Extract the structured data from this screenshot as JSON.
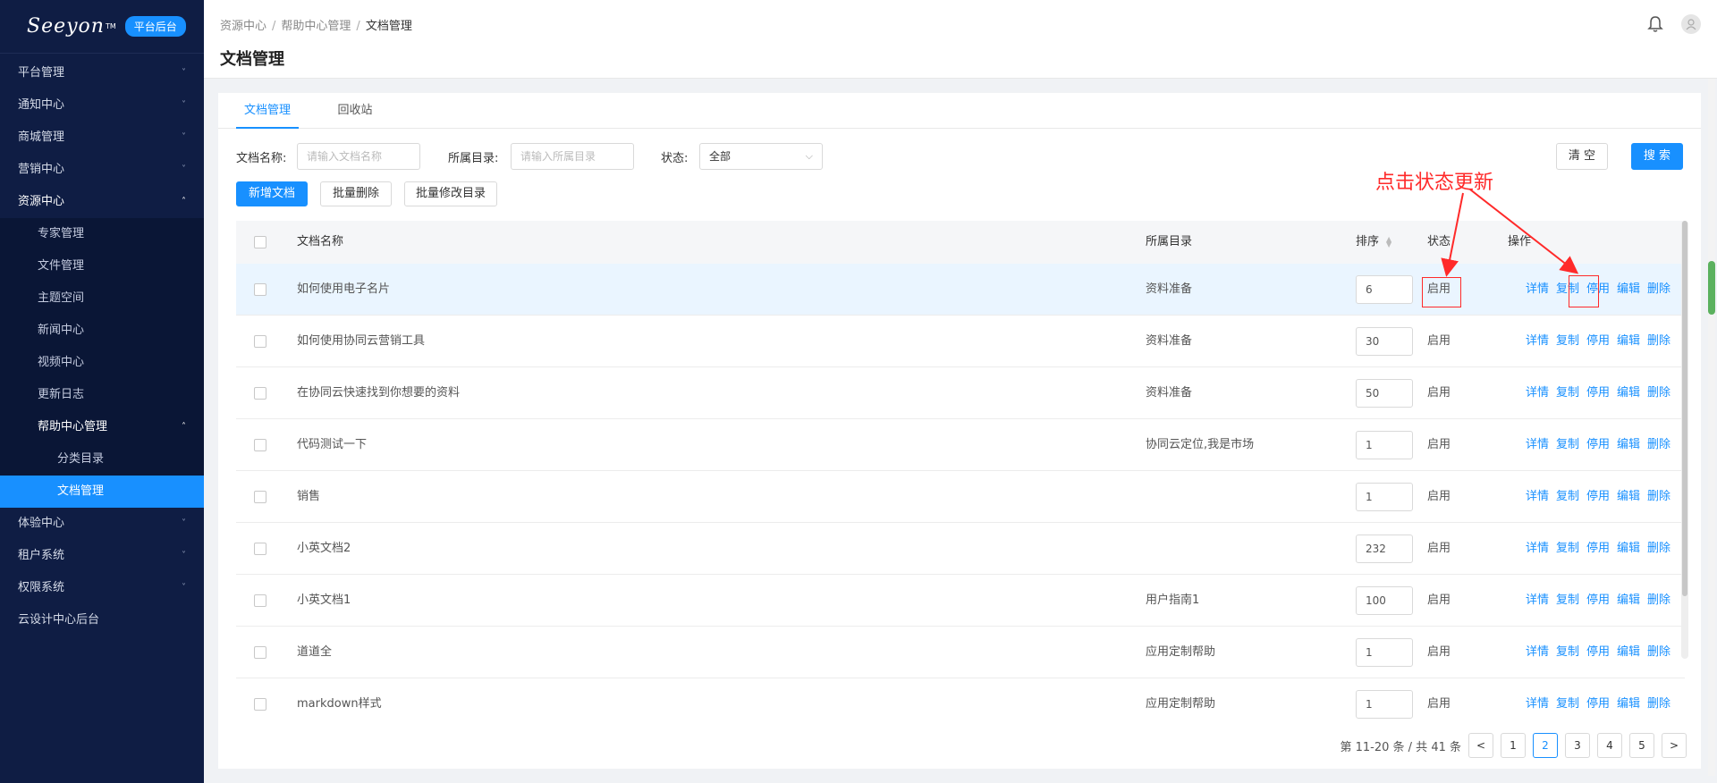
{
  "sidebar": {
    "logo": "Seeyon",
    "logo_tm": "TM",
    "badge": "平台后台",
    "items": [
      {
        "label": "平台管理",
        "arrow": "˅"
      },
      {
        "label": "通知中心",
        "arrow": "˅"
      },
      {
        "label": "商城管理",
        "arrow": "˅"
      },
      {
        "label": "营销中心",
        "arrow": "˅"
      },
      {
        "label": "资源中心",
        "arrow": "˄"
      },
      {
        "label": "专家管理"
      },
      {
        "label": "文件管理"
      },
      {
        "label": "主题空间"
      },
      {
        "label": "新闻中心"
      },
      {
        "label": "视频中心"
      },
      {
        "label": "更新日志"
      },
      {
        "label": "帮助中心管理",
        "arrow": "˄"
      },
      {
        "label": "分类目录"
      },
      {
        "label": "文档管理"
      },
      {
        "label": "体验中心",
        "arrow": "˅"
      },
      {
        "label": "租户系统",
        "arrow": "˅"
      },
      {
        "label": "权限系统",
        "arrow": "˅"
      },
      {
        "label": "云设计中心后台"
      }
    ]
  },
  "header": {
    "breadcrumb": [
      "资源中心",
      "帮助中心管理",
      "文档管理"
    ],
    "separator": "/",
    "title": "文档管理"
  },
  "tabs": [
    "文档管理",
    "回收站"
  ],
  "filters": {
    "name_label": "文档名称:",
    "name_placeholder": "请输入文档名称",
    "dir_label": "所属目录:",
    "dir_placeholder": "请输入所属目录",
    "status_label": "状态:",
    "status_value": "全部",
    "clear": "清 空",
    "search": "搜 索"
  },
  "actions": {
    "new_doc": "新增文档",
    "batch_delete": "批量删除",
    "batch_move": "批量修改目录"
  },
  "table": {
    "headers": {
      "name": "文档名称",
      "dir": "所属目录",
      "sort": "排序",
      "status": "状态",
      "ops": "操作"
    },
    "ops": [
      "详情",
      "复制",
      "停用",
      "编辑",
      "删除"
    ],
    "rows": [
      {
        "name": "如何使用电子名片",
        "dir": "资料准备",
        "sort": "6",
        "status": "启用"
      },
      {
        "name": "如何使用协同云营销工具",
        "dir": "资料准备",
        "sort": "30",
        "status": "启用"
      },
      {
        "name": "在协同云快速找到你想要的资料",
        "dir": "资料准备",
        "sort": "50",
        "status": "启用"
      },
      {
        "name": "代码测试一下",
        "dir": "协同云定位,我是市场",
        "sort": "1",
        "status": "启用"
      },
      {
        "name": "销售",
        "dir": "",
        "sort": "1",
        "status": "启用"
      },
      {
        "name": "小英文档2",
        "dir": "",
        "sort": "232",
        "status": "启用"
      },
      {
        "name": "小英文档1",
        "dir": "用户指南1",
        "sort": "100",
        "status": "启用"
      },
      {
        "name": "道道全",
        "dir": "应用定制帮助",
        "sort": "1",
        "status": "启用"
      },
      {
        "name": "markdown样式",
        "dir": "应用定制帮助",
        "sort": "1",
        "status": "启用"
      }
    ]
  },
  "pagination": {
    "summary": "第 11-20 条 / 共 41 条",
    "pages": [
      "1",
      "2",
      "3",
      "4",
      "5"
    ],
    "current": "2",
    "prev": "<",
    "next": ">"
  },
  "annotation": {
    "text": "点击状态更新",
    "color": "#ff2a2a"
  },
  "colors": {
    "sidebar_bg": "#0f1d44",
    "accent": "#1890ff",
    "annotation": "#ff2a2a"
  }
}
